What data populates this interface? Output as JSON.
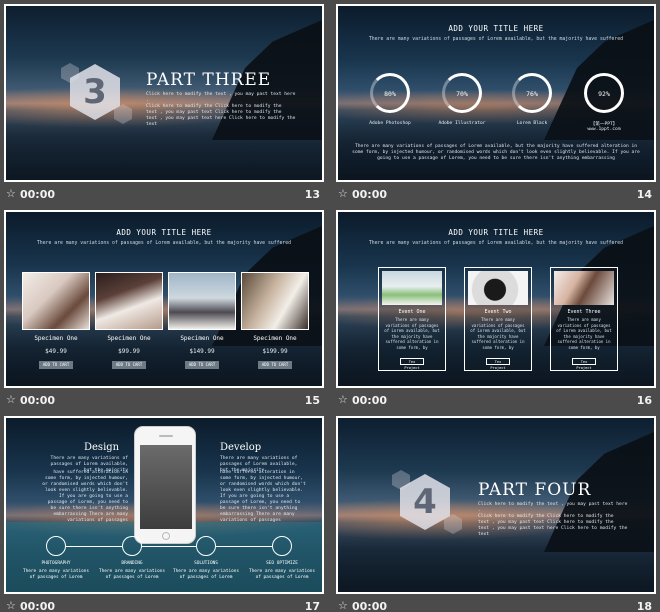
{
  "slides": [
    {
      "number": "13",
      "time": "00:00",
      "hex_digit": "3",
      "title": "PART THREE",
      "lines": [
        "Click here to modify the text , you may past text here .",
        "Click here to modify the  Click here to modify the",
        "text , you may past text  Click here to modify the",
        "text , you may past text here  Click here to modify the text"
      ]
    },
    {
      "number": "14",
      "time": "00:00",
      "title": "ADD YOUR TITLE HERE",
      "subtitle": "There are many variations of passages of Lorem available, but the majority have suffered",
      "rings": [
        {
          "value": "80%",
          "label": "Adobe Photoshop"
        },
        {
          "value": "70%",
          "label": "Adobe Illustrator"
        },
        {
          "value": "76%",
          "label": "Lorem Black"
        },
        {
          "value": "92%",
          "label": "【第一PPT】 www.1ppt.com"
        }
      ],
      "body": "There are many variations of passages of Lorem available, but the majority have suffered alteration in some form, by injected humour, or randomised words which don't look even slightly believable. If you are going to use a passage of Lorem, you need to be sure there isn't anything embarrassing"
    },
    {
      "number": "15",
      "time": "00:00",
      "title": "ADD YOUR TITLE HERE",
      "subtitle": "There are many variations of passages of Lorem available, but the majority have suffered",
      "items": [
        {
          "name": "Specimen One",
          "price": "$49.99",
          "button": "ADD TO CART"
        },
        {
          "name": "Specimen One",
          "price": "$99.99",
          "button": "ADD TO CART"
        },
        {
          "name": "Specimen One",
          "price": "$149.99",
          "button": "ADD TO CART"
        },
        {
          "name": "Specimen One",
          "price": "$199.99",
          "button": "ADD TO CART"
        }
      ]
    },
    {
      "number": "16",
      "time": "00:00",
      "title": "ADD YOUR TITLE HERE",
      "subtitle": "There are many variations of passages of Lorem available, but the majority have suffered",
      "cards": [
        {
          "name": "Event One",
          "desc": "There are many variations of passages of Lorem available, but the majority have suffered alteration in some form, by",
          "button": "Tex Project"
        },
        {
          "name": "Event Two",
          "desc": "There are many variations of passages of Lorem available, but the majority have suffered alteration in some form, by",
          "button": "Tex Project"
        },
        {
          "name": "Event Three",
          "desc": "There are many variations of passages of Lorem available, but the majority have suffered alteration in some form, by",
          "button": "Tex Project"
        }
      ]
    },
    {
      "number": "17",
      "time": "00:00",
      "left_title": "Design",
      "left_intro": "There are many variations of passages of Lorem available, but the majority",
      "left_body": "have suffered alteration in some form, by injected humour, or randomised words which don't look even slightly believable. If you are going to use a passage of Lorem, you need to be sure there isn't anything embarrassing There are many variations of passages",
      "right_title": "Develop",
      "right_intro": "There are many variations of passages of Lorem available, but the majority",
      "right_body": "have suffered alteration in some form, by injected humour, or randomised words which don't look even slightly believable. If you are going to use a passage of Lorem, you need to be sure there isn't anything embarrassing There are many variations of passages",
      "steps": [
        {
          "name": "PHOTOGRAPHY",
          "desc": "There are many variations of passages of Lorem"
        },
        {
          "name": "BRANDING",
          "desc": "There are many variations of passages of Lorem"
        },
        {
          "name": "SOLUTIONS",
          "desc": "There are many variations of passages of Lorem"
        },
        {
          "name": "SEO OPTIMIZE",
          "desc": "There are many variations of passages of Lorem"
        }
      ]
    },
    {
      "number": "18",
      "time": "00:00",
      "hex_digit": "4",
      "title": "PART FOUR",
      "lines": [
        "Click here to modify the text , you may past text here .",
        "Click here to modify the  Click here to modify the",
        "text , you may past text  Click here to modify the",
        "text , you may past text here  Click here to modify the text"
      ]
    }
  ],
  "icons": {
    "star": "star-icon"
  }
}
